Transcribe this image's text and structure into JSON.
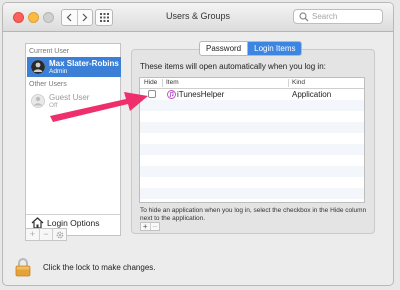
{
  "window": {
    "title": "Users & Groups"
  },
  "search": {
    "placeholder": "Search"
  },
  "sidebar": {
    "current_user_header": "Current User",
    "current_user": {
      "name": "Max Slater-Robins",
      "role": "Admin"
    },
    "other_users_header": "Other Users",
    "guest_user": {
      "name": "Guest User",
      "status": "Off"
    },
    "login_options_label": "Login Options",
    "tools": {
      "add": "+",
      "remove": "−"
    }
  },
  "tabs": [
    {
      "label": "Password",
      "selected": false
    },
    {
      "label": "Login Items",
      "selected": true
    }
  ],
  "login_items": {
    "description": "These items will open automatically when you log in:",
    "columns": {
      "hide": "Hide",
      "item": "Item",
      "kind": "Kind"
    },
    "rows": [
      {
        "hide": false,
        "item": "iTunesHelper",
        "kind": "Application"
      }
    ],
    "hint": "To hide an application when you log in, select the checkbox in the Hide column next to the application.",
    "add_button": "+",
    "remove_button": "−"
  },
  "lock": {
    "text": "Click the lock to make changes."
  },
  "colors": {
    "accent": "#3c85e0",
    "arrow": "#ee2f6b",
    "lock": "#e6a23a"
  },
  "icons": [
    "back-chevron-icon",
    "forward-chevron-icon",
    "grid-icon",
    "search-icon",
    "person-icon",
    "home-icon",
    "gear-icon",
    "itunes-icon",
    "lock-icon",
    "pointer-arrow"
  ]
}
